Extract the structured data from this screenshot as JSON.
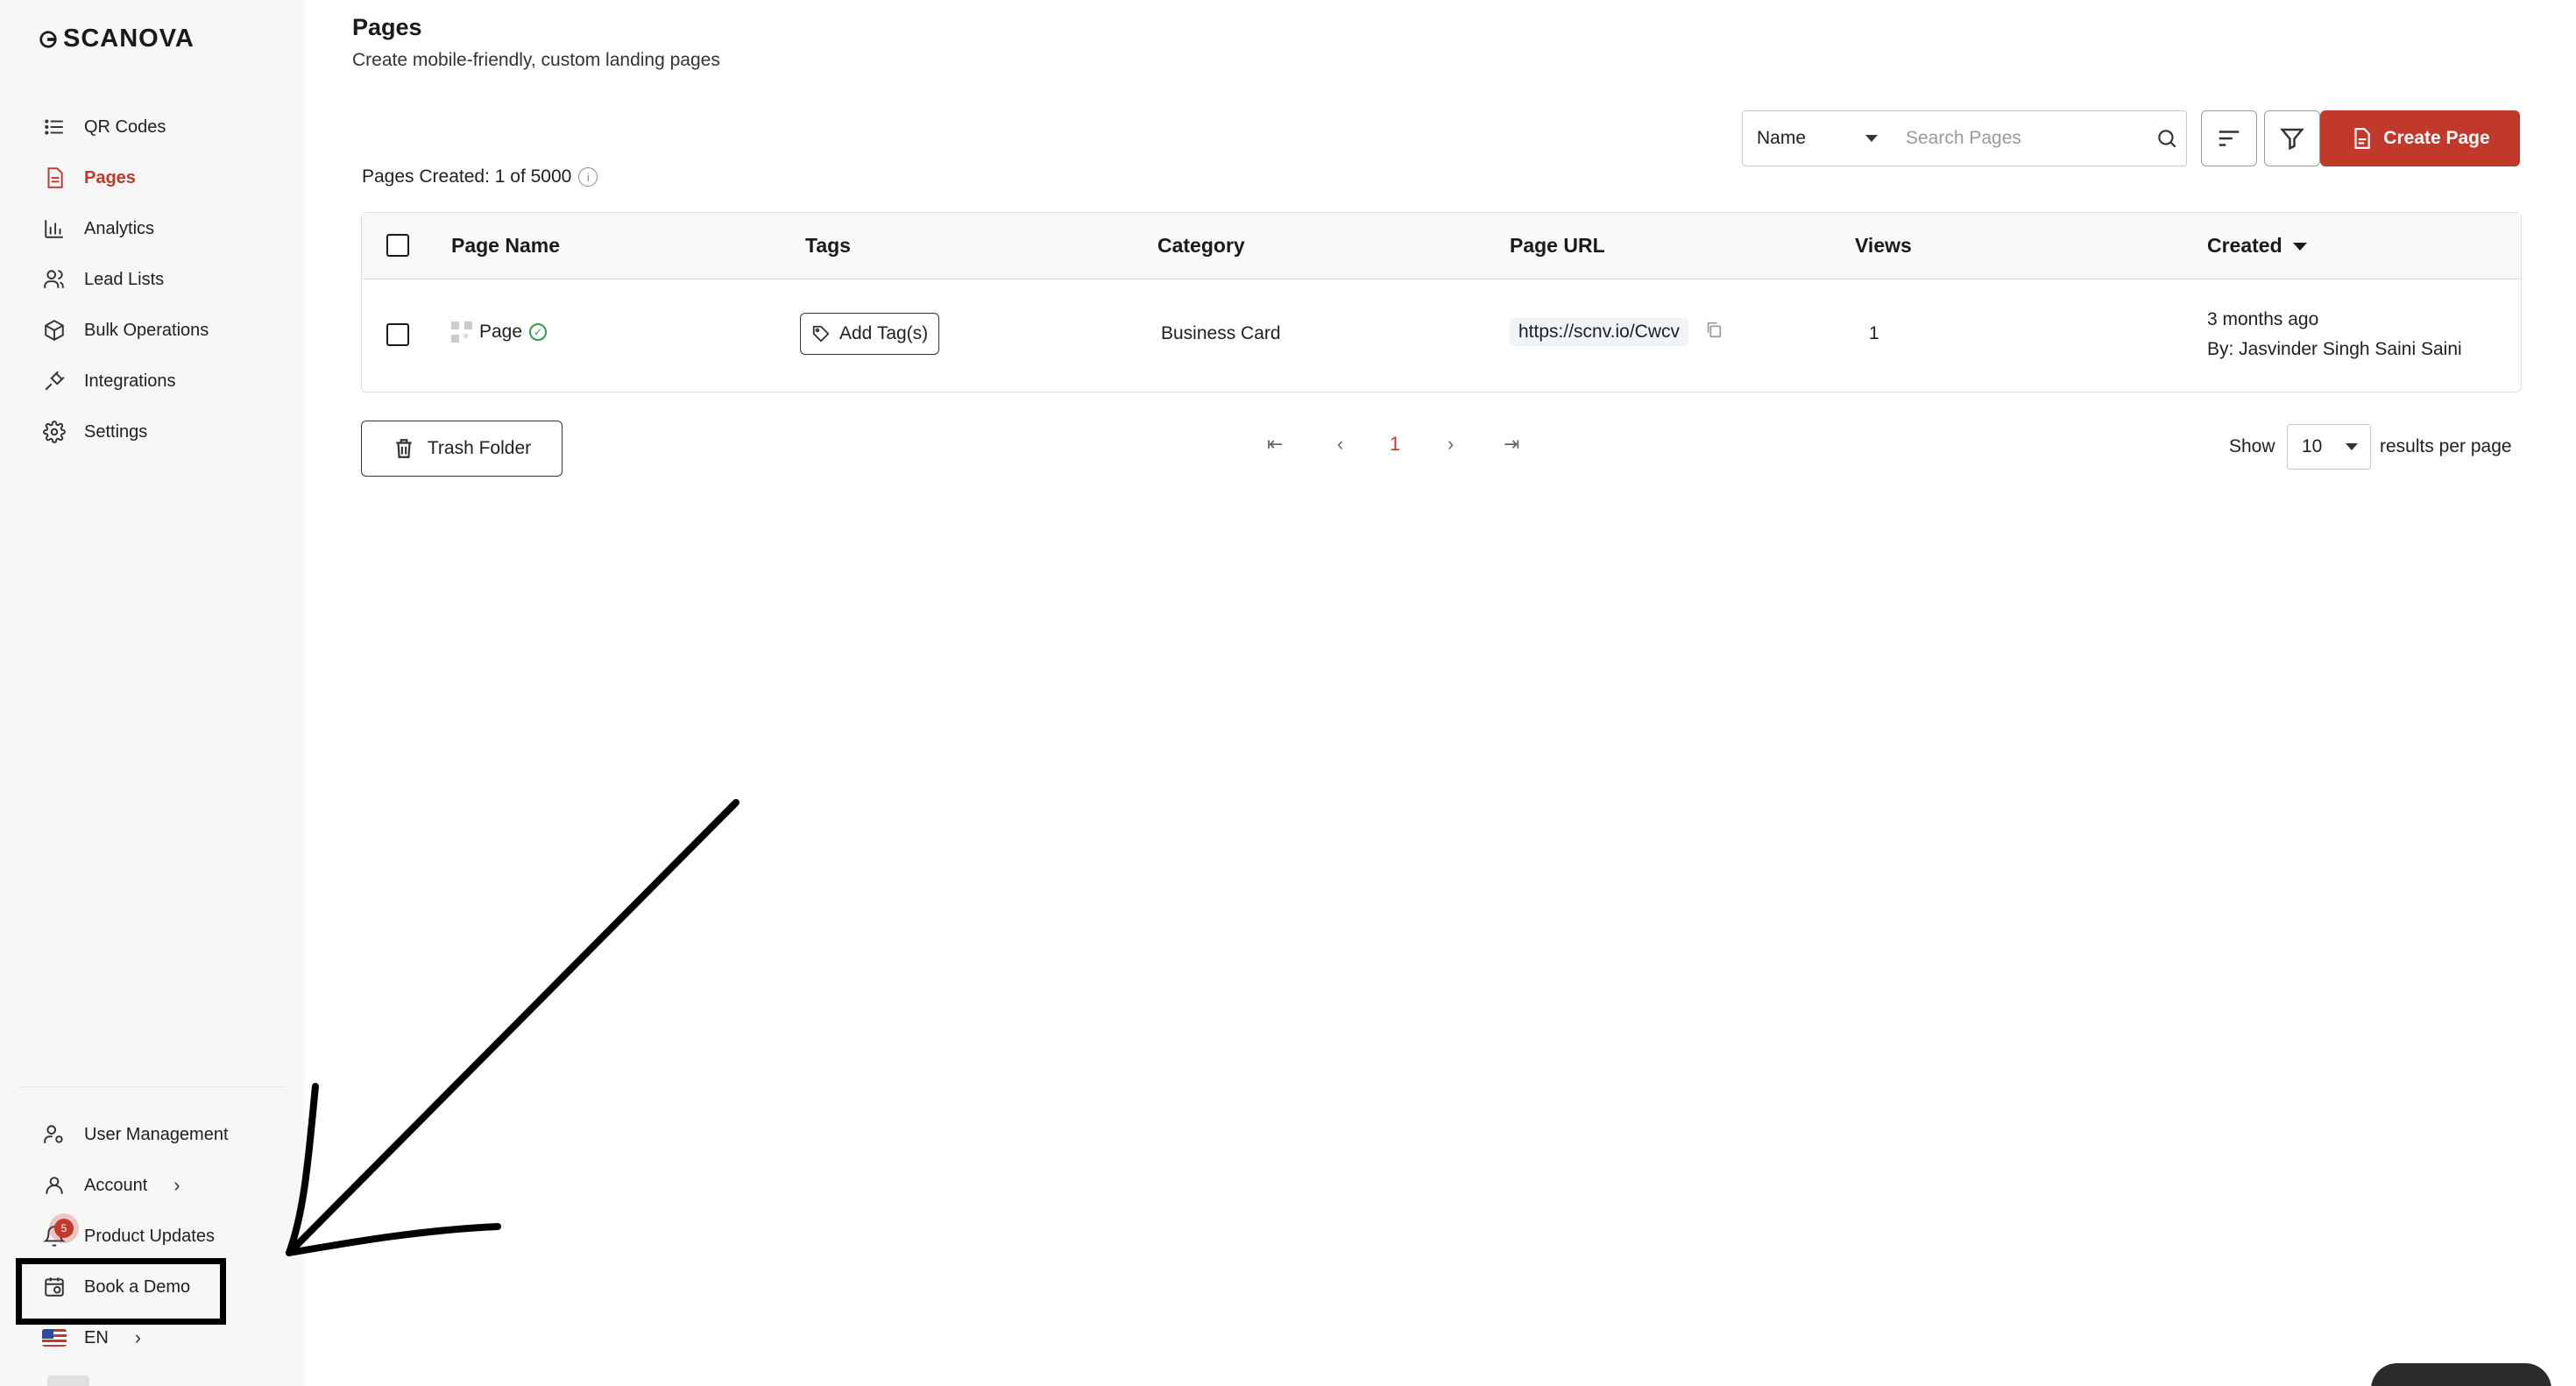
{
  "brand": {
    "logo_text": "SCANOVA"
  },
  "sidebar": {
    "items": [
      {
        "label": "QR Codes",
        "icon": "list-icon"
      },
      {
        "label": "Pages",
        "icon": "document-icon",
        "active": true
      },
      {
        "label": "Analytics",
        "icon": "bar-chart-icon"
      },
      {
        "label": "Lead Lists",
        "icon": "users-icon"
      },
      {
        "label": "Bulk Operations",
        "icon": "cube-icon"
      },
      {
        "label": "Integrations",
        "icon": "plug-icon"
      },
      {
        "label": "Settings",
        "icon": "gear-icon"
      }
    ],
    "bottom": {
      "user_management": "User Management",
      "account": "Account",
      "product_updates": "Product Updates",
      "product_updates_badge": "5",
      "book_demo": "Book a Demo",
      "language": "EN"
    }
  },
  "header": {
    "title": "Pages",
    "subtitle": "Create mobile-friendly, custom landing pages"
  },
  "toolbar": {
    "search_field_select": "Name",
    "search_placeholder": "Search Pages",
    "create_label": "Create Page"
  },
  "stats": {
    "pages_created": "Pages Created: 1 of 5000"
  },
  "table": {
    "columns": [
      "Page Name",
      "Tags",
      "Category",
      "Page URL",
      "Views",
      "Created"
    ],
    "rows": [
      {
        "page_name": "Page",
        "tag_button": "Add Tag(s)",
        "category": "Business Card",
        "url": "https://scnv.io/Cwcv",
        "views": "1",
        "created": "3 months ago",
        "created_by": "By: Jasvinder Singh Saini Saini"
      }
    ]
  },
  "footer": {
    "trash_label": "Trash Folder",
    "current_page": "1",
    "show_label": "Show",
    "per_page": "10",
    "results_label": "results per page"
  },
  "colors": {
    "accent": "#c0392b",
    "success": "#2e9d4c"
  }
}
